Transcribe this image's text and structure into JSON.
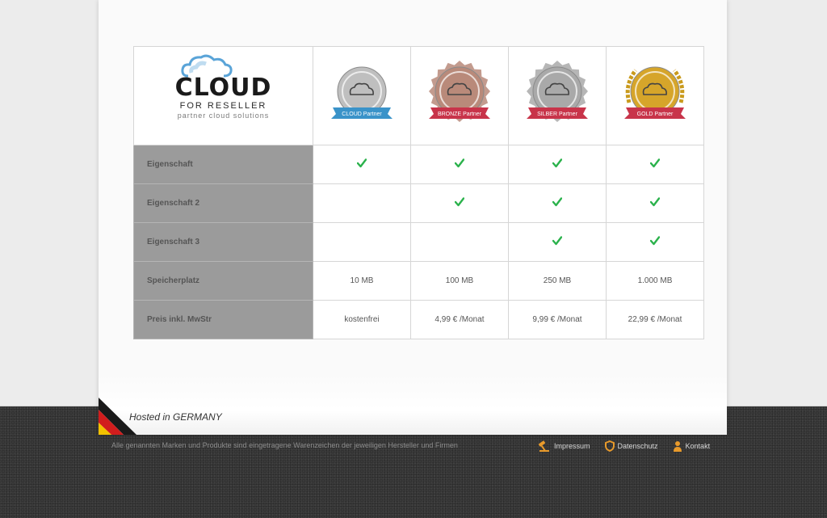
{
  "brand": {
    "logo_main": "CLOUD",
    "logo_sub": "FOR RESELLER",
    "logo_tagline": "partner cloud solutions"
  },
  "badges": [
    {
      "ribbon": "CLOUD Partner",
      "ribbon_color": "#3a93c9",
      "medal_color": "#bfbfbf"
    },
    {
      "ribbon": "BRONZE Partner",
      "ribbon_color": "#c8344a",
      "medal_color": "#b98a7a"
    },
    {
      "ribbon": "SILBER Partner",
      "ribbon_color": "#c8344a",
      "medal_color": "#a9a9a9"
    },
    {
      "ribbon": "GOLD Partner",
      "ribbon_color": "#c8344a",
      "medal_color": "#d6a52a"
    }
  ],
  "rows": [
    {
      "label": "Eigenschaft",
      "cells": [
        "check",
        "check",
        "check",
        "check"
      ]
    },
    {
      "label": "Eigenschaft 2",
      "cells": [
        "",
        "check",
        "check",
        "check"
      ]
    },
    {
      "label": "Eigenschaft 3",
      "cells": [
        "",
        "",
        "check",
        "check"
      ]
    },
    {
      "label": "Speicherplatz",
      "cells": [
        "10 MB",
        "100 MB",
        "250 MB",
        "1.000 MB"
      ]
    },
    {
      "label": "Preis inkl. MwStr",
      "cells": [
        "kostenfrei",
        "4,99 € /Monat",
        "9,99 € /Monat",
        "22,99 € /Monat"
      ]
    }
  ],
  "check_color": "#2bb24c",
  "footer": {
    "hosted": "Hosted in GERMANY",
    "copyright": "Alle genannten Marken und Produkte sind eingetragene Warenzeichen der jeweiligen Hersteller und Firmen",
    "links": [
      {
        "label": "Impressum",
        "icon": "gavel-icon"
      },
      {
        "label": "Datenschutz",
        "icon": "shield-icon"
      },
      {
        "label": "Kontakt",
        "icon": "person-icon"
      }
    ],
    "link_icon_color": "#e89a2b"
  }
}
